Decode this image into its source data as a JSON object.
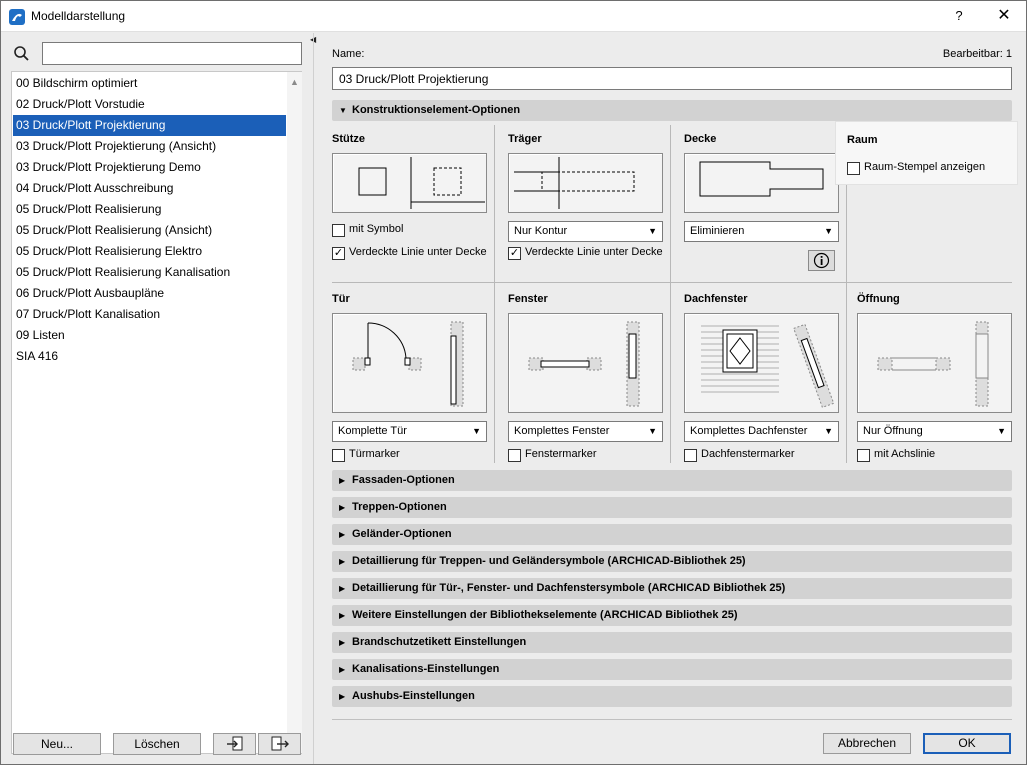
{
  "window": {
    "title": "Modelldarstellung",
    "help_label": "?",
    "close_label": "✕"
  },
  "sidebar": {
    "search_placeholder": "",
    "items": [
      {
        "label": "00 Bildschirm optimiert"
      },
      {
        "label": "02 Druck/Plott Vorstudie"
      },
      {
        "label": "03 Druck/Plott Projektierung"
      },
      {
        "label": "03 Druck/Plott Projektierung (Ansicht)"
      },
      {
        "label": "03 Druck/Plott Projektierung Demo"
      },
      {
        "label": "04 Druck/Plott Ausschreibung"
      },
      {
        "label": "05 Druck/Plott Realisierung"
      },
      {
        "label": "05 Druck/Plott Realisierung (Ansicht)"
      },
      {
        "label": "05 Druck/Plott Realisierung Elektro"
      },
      {
        "label": "05 Druck/Plott Realisierung Kanalisation"
      },
      {
        "label": "06 Druck/Plott Ausbaupläne"
      },
      {
        "label": "07 Druck/Plott Kanalisation"
      },
      {
        "label": "09 Listen"
      },
      {
        "label": "SIA 416"
      }
    ],
    "selected_item": "03 Druck/Plott Projektierung",
    "new_label": "Neu...",
    "delete_label": "Löschen"
  },
  "form": {
    "name_label": "Name:",
    "editable_label": "Bearbeitbar: 1",
    "name_value": "03 Druck/Plott Projektierung"
  },
  "sections": {
    "construction": "Konstruktionselement-Optionen",
    "collapsed": [
      "Fassaden-Optionen",
      "Treppen-Optionen",
      "Geländer-Optionen",
      "Detaillierung für Treppen- und Geländersymbole (ARCHICAD-Bibliothek 25)",
      "Detaillierung für Tür-, Fenster- und Dachfenstersymbole (ARCHICAD Bibliothek 25)",
      "Weitere Einstellungen der Bibliothekselemente (ARCHICAD Bibliothek 25)",
      "Brandschutzetikett Einstellungen",
      "Kanalisations-Einstellungen",
      "Aushubs-Einstellungen"
    ]
  },
  "elements": {
    "stuetze": {
      "title": "Stütze",
      "symbol_label": "mit Symbol",
      "symbol_checked": false,
      "hidden_label": "Verdeckte Linie unter Decke",
      "hidden_checked": true
    },
    "traeger": {
      "title": "Träger",
      "dropdown": "Nur Kontur",
      "hidden_label": "Verdeckte Linie unter Decke",
      "hidden_checked": true
    },
    "decke": {
      "title": "Decke",
      "dropdown": "Eliminieren"
    },
    "raum": {
      "title": "Raum",
      "stamp_label": "Raum-Stempel anzeigen",
      "stamp_checked": false
    },
    "tuer": {
      "title": "Tür",
      "dropdown": "Komplette Tür",
      "marker_label": "Türmarker",
      "marker_checked": false
    },
    "fenster": {
      "title": "Fenster",
      "dropdown": "Komplettes Fenster",
      "marker_label": "Fenstermarker",
      "marker_checked": false
    },
    "dachfenster": {
      "title": "Dachfenster",
      "dropdown": "Komplettes Dachfenster",
      "marker_label": "Dachfenstermarker",
      "marker_checked": false
    },
    "oeffnung": {
      "title": "Öffnung",
      "dropdown": "Nur Öffnung",
      "axis_label": "mit Achslinie",
      "axis_checked": false
    }
  },
  "footer": {
    "cancel_label": "Abbrechen",
    "ok_label": "OK"
  },
  "colors": {
    "selection": "#1b5fb8",
    "section_header": "#d2d2d2"
  }
}
